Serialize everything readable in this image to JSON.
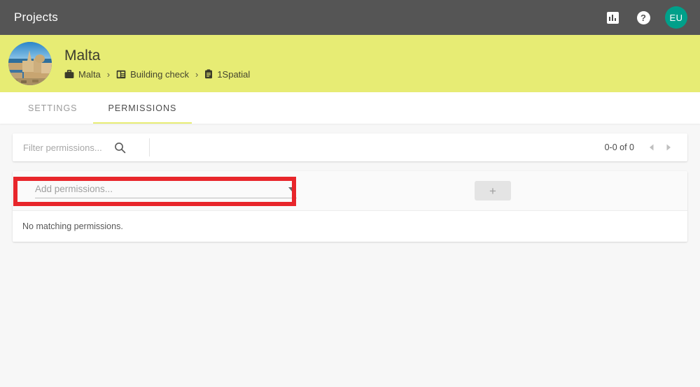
{
  "appbar": {
    "title": "Projects",
    "insights_icon": "bar-chart-icon",
    "help_icon": "?",
    "help_icon_name": "help-icon",
    "avatar_initials": "EU",
    "avatar_color": "#00a08a"
  },
  "banner": {
    "project_name": "Malta",
    "photo_alt": "malta-valletta-photo",
    "background_color": "#e7ec74",
    "breadcrumb": [
      {
        "label": "Malta",
        "icon": "briefcase-icon"
      },
      {
        "label": "Building check",
        "icon": "dashboard-icon"
      },
      {
        "label": "1Spatial",
        "icon": "clipboard-icon"
      }
    ],
    "separator": "›"
  },
  "tabs": [
    {
      "label": "SETTINGS",
      "active": false
    },
    {
      "label": "PERMISSIONS",
      "active": true
    }
  ],
  "filter_bar": {
    "placeholder": "Filter permissions...",
    "value": "",
    "search_icon": "search-icon",
    "pagination": {
      "range_label": "0-0 of 0",
      "prev_icon": "◂",
      "next_icon": "▸"
    }
  },
  "permissions_panel": {
    "add_select": {
      "placeholder": "Add permissions...",
      "value": "",
      "caret_icon": "chevron-down-icon"
    },
    "add_button_label": "+",
    "empty_message": "No matching permissions."
  },
  "annotation": {
    "highlight_color": "#e8262b",
    "target": "add-permissions-select"
  }
}
